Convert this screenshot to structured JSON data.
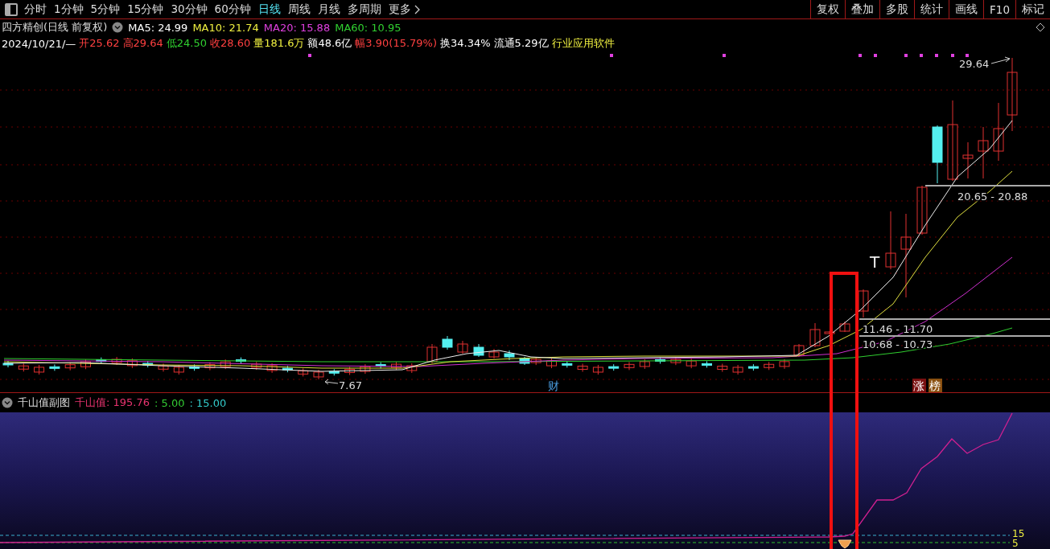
{
  "toolbar": {
    "periods": [
      {
        "label": "分时",
        "selected": false
      },
      {
        "label": "1分钟",
        "selected": false
      },
      {
        "label": "5分钟",
        "selected": false
      },
      {
        "label": "15分钟",
        "selected": false
      },
      {
        "label": "30分钟",
        "selected": false
      },
      {
        "label": "60分钟",
        "selected": false
      },
      {
        "label": "日线",
        "selected": true
      },
      {
        "label": "周线",
        "selected": false
      },
      {
        "label": "月线",
        "selected": false
      },
      {
        "label": "多周期",
        "selected": false
      }
    ],
    "more": "更多",
    "tools": [
      "复权",
      "叠加",
      "多股",
      "统计",
      "画线",
      "F10",
      "标记"
    ]
  },
  "chart": {
    "title": "四方精创(日线 前复权)",
    "ma": [
      {
        "label": "MA5: 24.99",
        "color": "#ffffff"
      },
      {
        "label": "MA10: 21.74",
        "color": "#f0f040"
      },
      {
        "label": "MA20: 15.88",
        "color": "#e040e0"
      },
      {
        "label": "MA60: 10.95",
        "color": "#30d030"
      }
    ],
    "quote": [
      {
        "text": "2024/10/21/—",
        "color": "#ffffff"
      },
      {
        "text": "开25.62",
        "color": "#ff4040"
      },
      {
        "text": "高29.64",
        "color": "#ff4040"
      },
      {
        "text": "低24.50",
        "color": "#30d030"
      },
      {
        "text": "收28.60",
        "color": "#ff4040"
      },
      {
        "text": "量181.6万",
        "color": "#f0f040"
      },
      {
        "text": "额48.6亿",
        "color": "#ffffff"
      },
      {
        "text": "幅3.90(15.79%)",
        "color": "#ff4040"
      },
      {
        "text": "换34.34%",
        "color": "#ffffff"
      },
      {
        "text": "流通5.29亿",
        "color": "#ffffff"
      },
      {
        "text": "行业应用软件",
        "color": "#f0f040"
      }
    ],
    "high_label": "29.64",
    "low_label": "7.67",
    "t_mark": "T",
    "ranges": [
      "20.65 - 20.88",
      "11.46 - 11.70",
      "10.68 - 10.73"
    ],
    "events": [
      {
        "text": "财",
        "kind": "news"
      },
      {
        "text": "涨",
        "kind": "limit"
      },
      {
        "text": "榜",
        "kind": "list"
      }
    ]
  },
  "indicator": {
    "title": "千山值副图",
    "values": [
      {
        "text": "千山值: 195.76",
        "color": "#e8336f"
      },
      {
        "text": ": 5.00",
        "color": "#33cc33"
      },
      {
        "text": ": 15.00",
        "color": "#33cccc"
      }
    ],
    "levels": [
      "15",
      "5"
    ]
  }
}
